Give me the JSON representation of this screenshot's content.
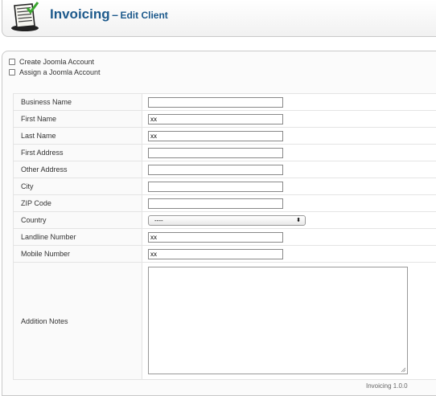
{
  "header": {
    "app_name": "Invoicing",
    "separator": "–",
    "page_name": "Edit Client"
  },
  "options": [
    {
      "label": "Create Joomla Account",
      "checked": false
    },
    {
      "label": "Assign a Joomla Account",
      "checked": false
    }
  ],
  "form": {
    "business_name": {
      "label": "Business Name",
      "value": ""
    },
    "first_name": {
      "label": "First Name",
      "value": "xx"
    },
    "last_name": {
      "label": "Last Name",
      "value": "xx"
    },
    "first_address": {
      "label": "First Address",
      "value": ""
    },
    "other_address": {
      "label": "Other Address",
      "value": ""
    },
    "city": {
      "label": "City",
      "value": ""
    },
    "zip_code": {
      "label": "ZIP Code",
      "value": ""
    },
    "country": {
      "label": "Country",
      "value": "----"
    },
    "landline": {
      "label": "Landline Number",
      "value": "xx"
    },
    "mobile": {
      "label": "Mobile Number",
      "value": "xx"
    },
    "notes": {
      "label": "Addition Notes",
      "value": ""
    }
  },
  "footer": {
    "version_text": "Invoicing 1.0.0"
  },
  "colors": {
    "title": "#1d5a8c",
    "border": "#c9c9c9"
  },
  "icons": {
    "logo": "invoice-document-icon",
    "select_arrows": "updown-arrows-icon",
    "resize": "resize-grip-icon"
  }
}
